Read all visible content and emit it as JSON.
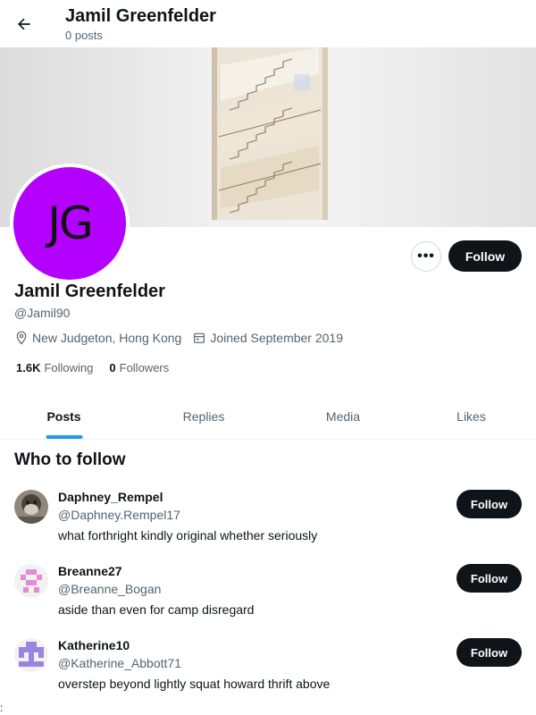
{
  "header": {
    "name": "Jamil Greenfelder",
    "posts": "0 posts"
  },
  "profile": {
    "initials": "JG",
    "avatar_color": "#b300ff",
    "name": "Jamil Greenfelder",
    "handle": "@Jamil90",
    "location": "New Judgeton, Hong Kong",
    "joined": "Joined September 2019",
    "following_count": "1.6K",
    "following_label": "Following",
    "followers_count": "0",
    "followers_label": "Followers",
    "follow_label": "Follow",
    "more_label": "•••"
  },
  "tabs": [
    {
      "label": "Posts",
      "active": true
    },
    {
      "label": "Replies"
    },
    {
      "label": "Media"
    },
    {
      "label": "Likes"
    }
  ],
  "who_to_follow": {
    "title": "Who to follow",
    "users": [
      {
        "name": "Daphney_Rempel",
        "handle": "@Daphney.Rempel17",
        "bio": "what forthright kindly original whether seriously",
        "follow_label": "Follow"
      },
      {
        "name": "Breanne27",
        "handle": "@Breanne_Bogan",
        "bio": "aside than even for camp disregard",
        "follow_label": "Follow"
      },
      {
        "name": "Katherine10",
        "handle": "@Katherine_Abbott71",
        "bio": "overstep beyond lightly squat howard thrift above",
        "follow_label": "Follow"
      }
    ]
  },
  "stray_text": ":",
  "colors": {
    "accent": "#1d9bf0",
    "button_dark": "#0f1419",
    "muted": "#536471"
  }
}
